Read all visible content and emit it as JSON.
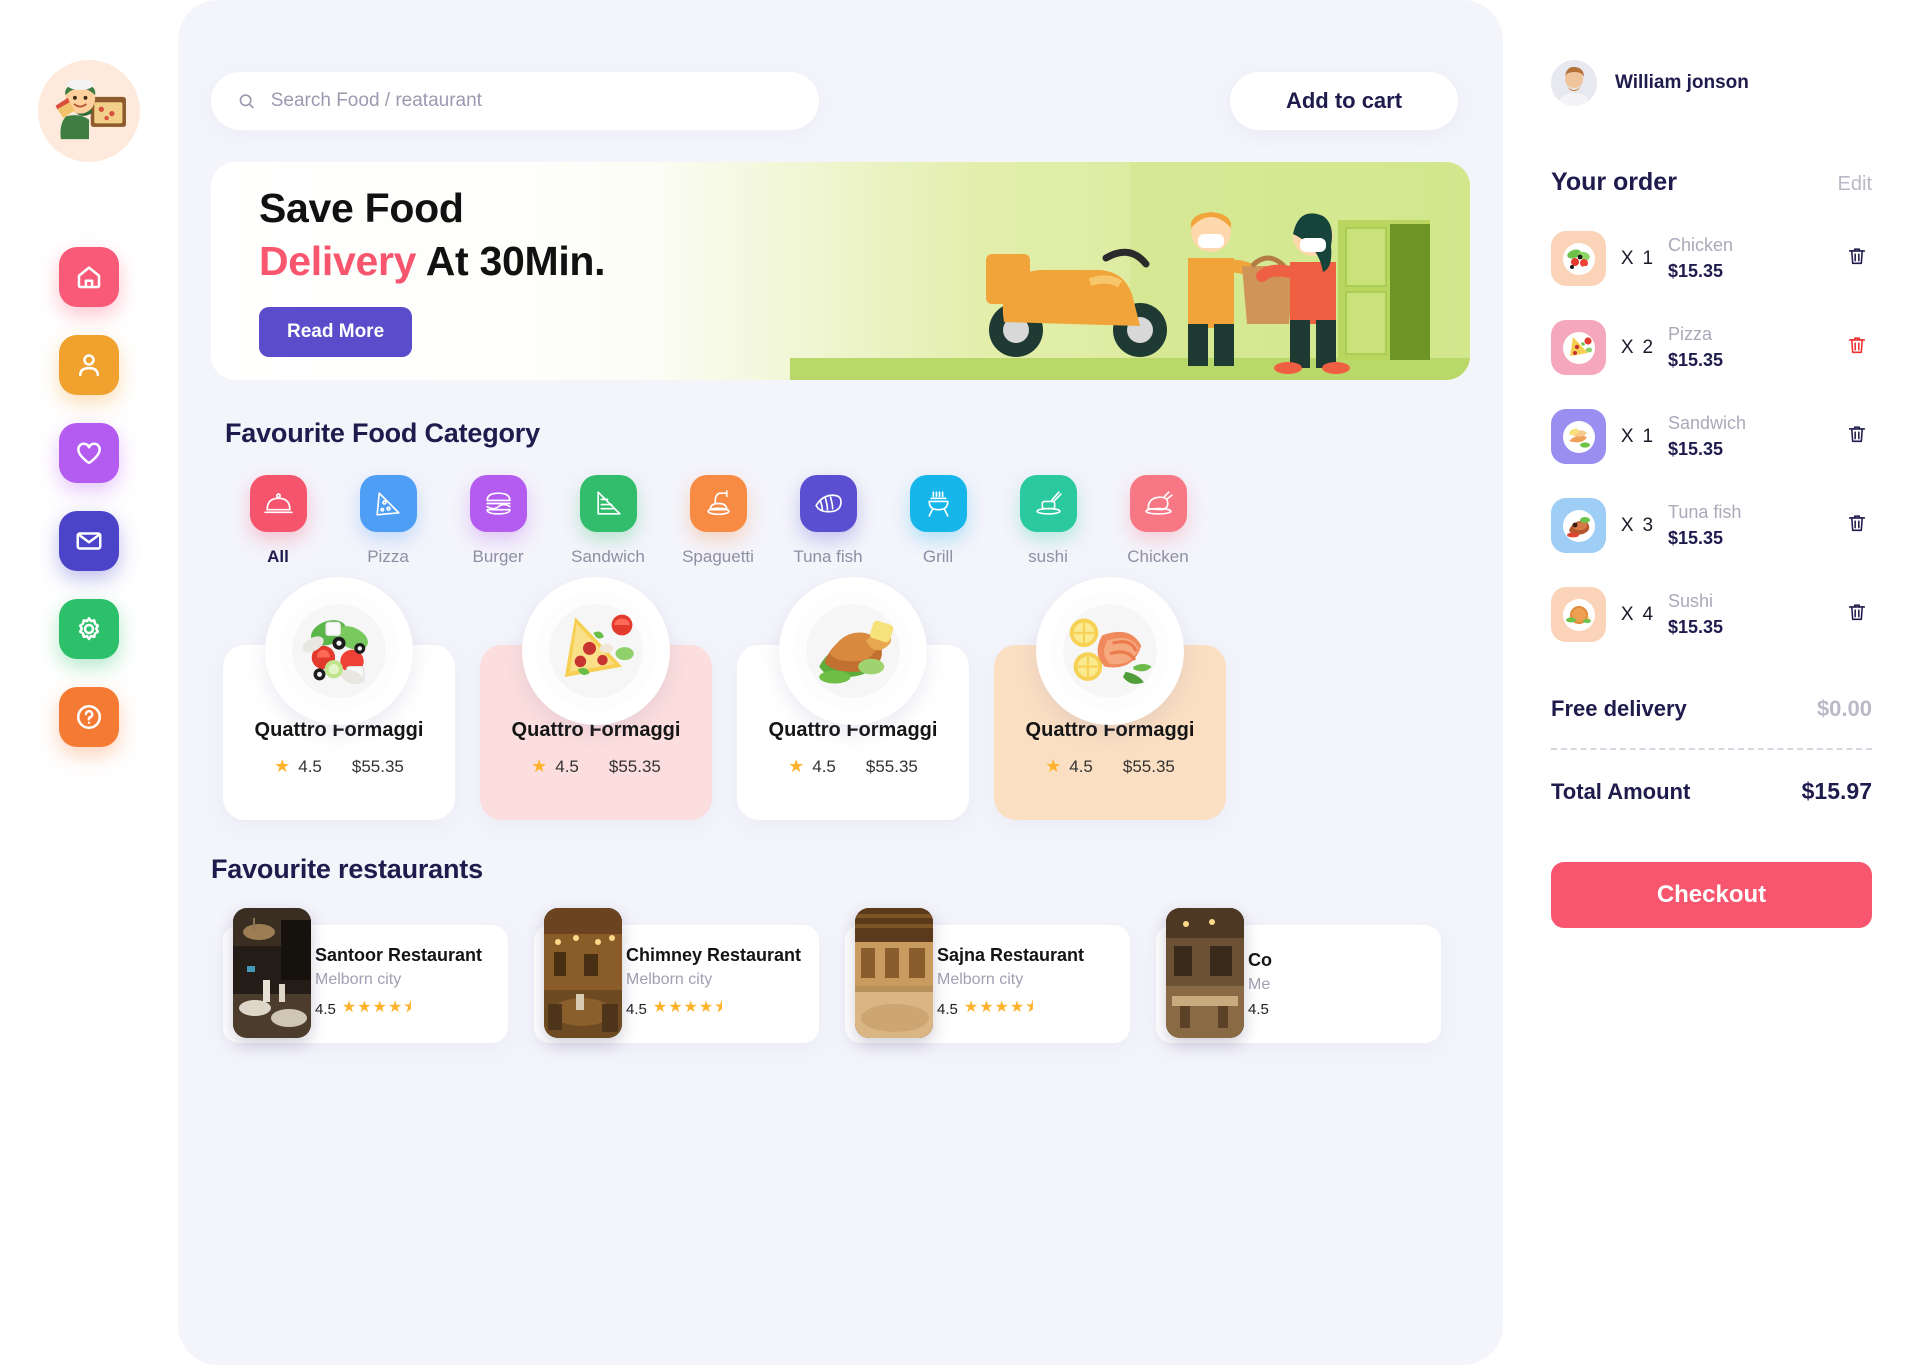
{
  "sidebar": {
    "logo_icon": "pizza-delivery-boy-logo",
    "items": [
      {
        "name": "home",
        "icon": "home-icon",
        "color": "#f85a77"
      },
      {
        "name": "profile",
        "icon": "user-icon",
        "color": "#f0a12e"
      },
      {
        "name": "favorites",
        "icon": "heart-icon",
        "color": "#b45cf0"
      },
      {
        "name": "messages",
        "icon": "mail-icon",
        "color": "#4b44c9"
      },
      {
        "name": "settings",
        "icon": "gear-icon",
        "color": "#2cc06a"
      },
      {
        "name": "help",
        "icon": "question-icon",
        "color": "#f57b35"
      }
    ]
  },
  "topbar": {
    "search_placeholder": "Search Food / reataurant",
    "search_value": "",
    "search_icon": "search-icon",
    "add_to_cart_label": "Add to cart"
  },
  "banner": {
    "line1": "Save Food",
    "line2_highlight": "Delivery",
    "line2_rest": " At 30Min.",
    "button_label": "Read More",
    "illustration": "delivery-handoff-illustration"
  },
  "categories": {
    "title": "Favourite Food Category",
    "items": [
      {
        "label": "All",
        "icon": "cloche-icon",
        "color": "#f4556d",
        "active": true
      },
      {
        "label": "Pizza",
        "icon": "pizza-icon",
        "color": "#4e9ef5",
        "active": false
      },
      {
        "label": "Burger",
        "icon": "burger-icon",
        "color": "#b45cf0",
        "active": false
      },
      {
        "label": "Sandwich",
        "icon": "sandwich-icon",
        "color": "#32bd6c",
        "active": false
      },
      {
        "label": "Spaguetti",
        "icon": "spaghetti-icon",
        "color": "#f78b43",
        "active": false
      },
      {
        "label": "Tuna fish",
        "icon": "fish-fillet-icon",
        "color": "#5a4fd0",
        "active": false
      },
      {
        "label": "Grill",
        "icon": "grill-icon",
        "color": "#17b6ea",
        "active": false
      },
      {
        "label": "sushi",
        "icon": "sushi-icon",
        "color": "#2ac9a0",
        "active": false
      },
      {
        "label": "Chicken",
        "icon": "chicken-leg-icon",
        "color": "#f87784",
        "active": false
      }
    ]
  },
  "food_cards": [
    {
      "name": "Quattro Formaggi",
      "rating": "4.5",
      "price": "$55.35",
      "bg": "#ffffff",
      "dish": "salad-dish"
    },
    {
      "name": "Quattro Formaggi",
      "rating": "4.5",
      "price": "$55.35",
      "bg": "#fcdede",
      "dish": "pizza-dish"
    },
    {
      "name": "Quattro Formaggi",
      "rating": "4.5",
      "price": "$55.35",
      "bg": "#ffffff",
      "dish": "chicken-dish"
    },
    {
      "name": "Quattro Formaggi",
      "rating": "4.5",
      "price": "$55.35",
      "bg": "#fbdfc2",
      "dish": "salmon-dish"
    }
  ],
  "restaurants": {
    "title": "Favourite restaurants",
    "items": [
      {
        "name": "Santoor Restaurant",
        "city": "Melborn city",
        "rating": "4.5",
        "stars": "★★★★⯨",
        "photo": "restaurant-interior-dark"
      },
      {
        "name": "Chimney Restaurant",
        "city": "Melborn city",
        "rating": "4.5",
        "stars": "★★★★⯨",
        "photo": "restaurant-interior-warm"
      },
      {
        "name": "Sajna Restaurant",
        "city": "Melborn city",
        "rating": "4.5",
        "stars": "★★★★⯨",
        "photo": "restaurant-interior-wood"
      },
      {
        "name": "Co",
        "city": "Me",
        "rating": "4.5",
        "stars": "",
        "photo": "restaurant-interior-table"
      }
    ]
  },
  "order": {
    "user_name": "William jonson",
    "avatar_icon": "user-avatar",
    "title": "Your order",
    "edit_label": "Edit",
    "items": [
      {
        "name": "Chicken",
        "qty_prefix": "X",
        "qty": "1",
        "price": "$15.35",
        "bg": "#fad3b8",
        "dish": "salad-mini",
        "delete_icon": "trash-icon",
        "delete_red": false
      },
      {
        "name": "Pizza",
        "qty_prefix": "X",
        "qty": "2",
        "price": "$15.35",
        "bg": "#f5a8bd",
        "dish": "pizza-mini",
        "delete_icon": "trash-icon",
        "delete_red": true
      },
      {
        "name": "Sandwich",
        "qty_prefix": "X",
        "qty": "1",
        "price": "$15.35",
        "bg": "#9a8ef0",
        "dish": "sandwich-mini",
        "delete_icon": "trash-icon",
        "delete_red": false
      },
      {
        "name": "Tuna fish",
        "qty_prefix": "X",
        "qty": "3",
        "price": "$15.35",
        "bg": "#9ecdf5",
        "dish": "tuna-mini",
        "delete_icon": "trash-icon",
        "delete_red": false
      },
      {
        "name": "Sushi",
        "qty_prefix": "X",
        "qty": "4",
        "price": "$15.35",
        "bg": "#fad3b8",
        "dish": "sushi-mini",
        "delete_icon": "trash-icon",
        "delete_red": false
      }
    ],
    "free_delivery_label": "Free delivery",
    "free_delivery_value": "$0.00",
    "total_label": "Total Amount",
    "total_value": "$15.97",
    "checkout_label": "Checkout"
  }
}
